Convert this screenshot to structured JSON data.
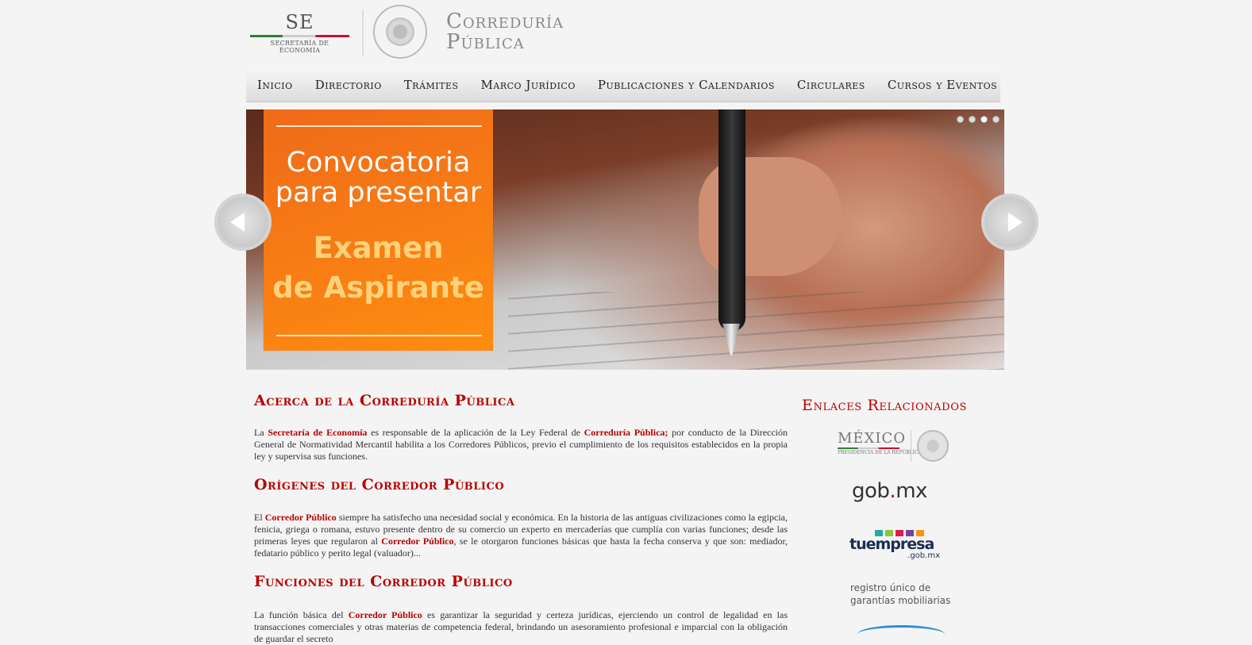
{
  "header": {
    "se_mark": "SE",
    "se_sub": "SECRETARÍA DE ECONOMÍA",
    "brand_line1": "Correduría",
    "brand_line2": "Pública"
  },
  "nav": [
    "Inicio",
    "Directorio",
    "Trámites",
    "Marco Jurídico",
    "Publicaciones y Calendarios",
    "Circulares",
    "Cursos y Eventos"
  ],
  "slider": {
    "line1": "Convocatoria",
    "line2": "para presentar",
    "line3": "Examen",
    "line4": "de Aspirante",
    "dots": 4,
    "active_dot": 3,
    "colors": {
      "panel": "#ff7f17",
      "highlight": "#ffd27a"
    }
  },
  "main": {
    "s1_title": "Acerca de la Correduría Pública",
    "s1_p": {
      "a": "La ",
      "b": "Secretaría de Economía",
      "c": " es responsable de la aplicación de la Ley Federal de ",
      "d": "Correduría Pública;",
      "e": " por conducto de la Dirección General de Normatividad Mercantil habilita a los Corredores Públicos, previo el cumplimiento de los requisitos establecidos en la propia ley y supervisa sus funciones."
    },
    "s2_title": "Orígenes del Corredor Público",
    "s2_p": {
      "a": "El ",
      "b": "Corredor Público",
      "c": " siempre ha satisfecho una necesidad social y económica. En la historia de las antiguas civilizaciones como la egipcia, fenicia, griega o romana, estuvo presente dentro de su comercio un experto en mercaderías que cumplía con varias funciones; desde las primeras leyes que regularon al ",
      "d": "Corredor Público",
      "e": ", se le otorgaron funciones básicas que hasta la fecha conserva y que son: mediador, fedatario público y perito legal (valuador)..."
    },
    "s3_title": "Funciones del Corredor Público",
    "s3_p": {
      "a": "La función básica del ",
      "b": "Corredor Público",
      "c": " es garantizar la seguridad y certeza jurídicas, ejerciendo un control de legalidad en las transacciones comerciales y otras materias de competencia federal, brindando un asesoramiento profesional e imparcial con la obligación de guardar el secreto"
    }
  },
  "side": {
    "title": "Enlaces Relacionados",
    "mexico_word": "MÉXICO",
    "mexico_sub": "PRESIDENCIA DE LA REPÚBLICA",
    "gob_a": "gob",
    "gob_dot": ".",
    "gob_b": "mx",
    "tue_word": "tuempresa",
    "tue_sub": ".gob.mx",
    "tue_colors": [
      "#2aa8a0",
      "#8cc63f",
      "#e01b4c",
      "#7a3e9d",
      "#f7941d"
    ],
    "reg_line1": "registro único de",
    "reg_line2": "garantías mobiliarias",
    "brand_red": "#bb0000"
  }
}
